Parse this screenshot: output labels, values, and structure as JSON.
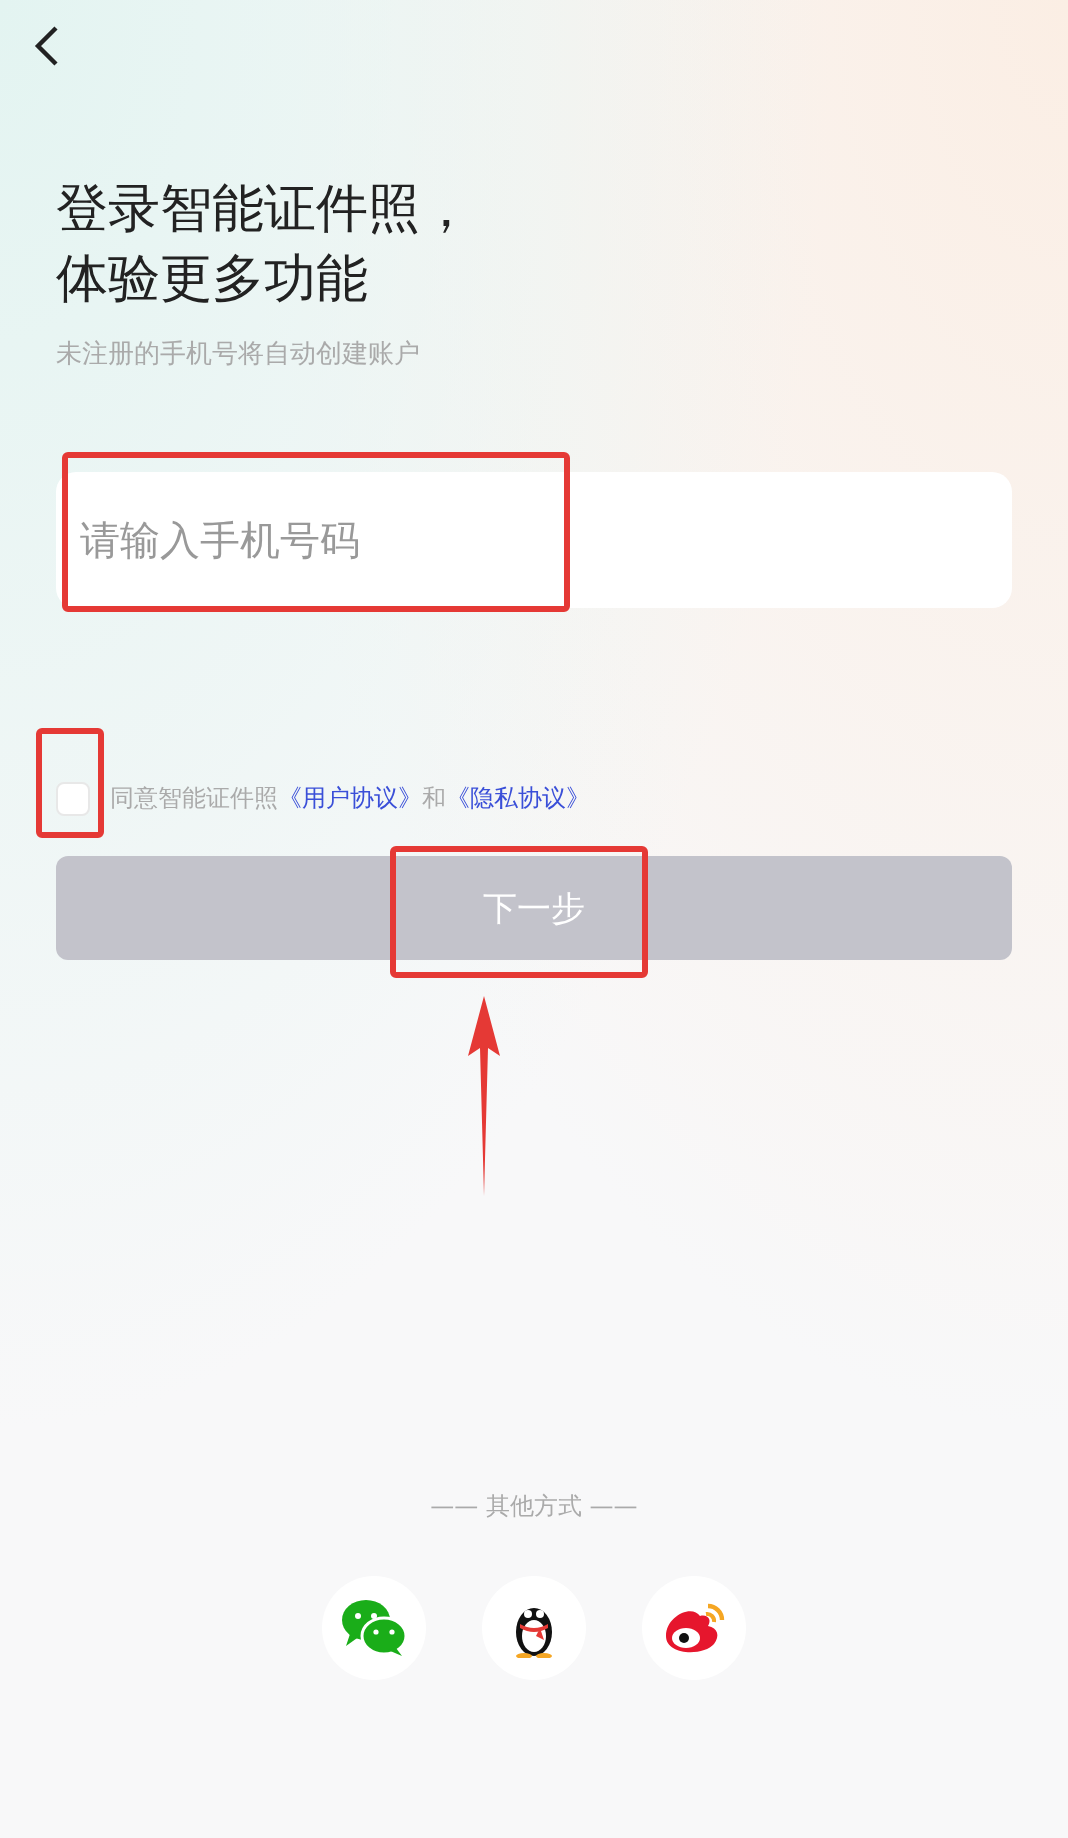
{
  "header": {
    "title_lines": [
      "登录智能证件照，",
      "体验更多功能"
    ],
    "subtitle": "未注册的手机号将自动创建账户"
  },
  "phone_input": {
    "placeholder": "请输入手机号码",
    "highlighted": true
  },
  "agreement": {
    "checked": false,
    "checkbox_highlighted": true,
    "prefix": "同意智能证件照",
    "links": [
      "《用户协议》",
      "《隐私协议》"
    ],
    "joiner": "和"
  },
  "next_button": {
    "label": "下一步",
    "disabled": true,
    "highlighted": true,
    "pointed_by_arrow": true
  },
  "other_methods": {
    "label": "—— 其他方式 ——",
    "providers": [
      {
        "kind": "wechat"
      },
      {
        "kind": "qq"
      },
      {
        "kind": "weibo"
      }
    ]
  }
}
